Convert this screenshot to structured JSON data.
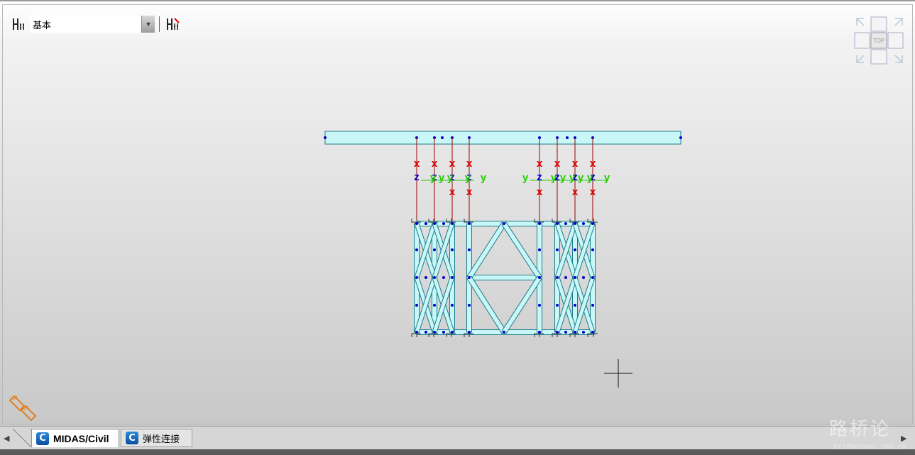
{
  "toolbar": {
    "view_select_value": "基本"
  },
  "view_cube": {
    "label": "TOP"
  },
  "model": {
    "local_axis_labels": {
      "x": "x",
      "y": "y",
      "z": "z"
    },
    "colors": {
      "member_fill": "#c9f7f7",
      "member_stroke": "#1c7b8a",
      "node": "#0000cc",
      "elastic_link": "#a00000",
      "axis_x": "#e00000",
      "axis_y": "#22cc00",
      "axis_z": "#0000cc"
    }
  },
  "tabs": [
    {
      "label": "MIDAS/Civil",
      "icon": "midas-civil-icon",
      "active": true
    },
    {
      "label": "弹性连接",
      "icon": "midas-civil-icon",
      "active": false
    }
  ],
  "watermark": {
    "text": "路桥论",
    "sub": "bridgeroad.com.cn"
  },
  "icons": {
    "view_mode_icon": "grid-view-icon",
    "view_mode_icon_2": "grid-view-edit-icon",
    "nav_left": "chevron-left-icon",
    "nav_right": "chevron-right-icon",
    "cursor": "crosshair-icon",
    "snap": "pencil-icon"
  },
  "app_icon_letter": "C"
}
